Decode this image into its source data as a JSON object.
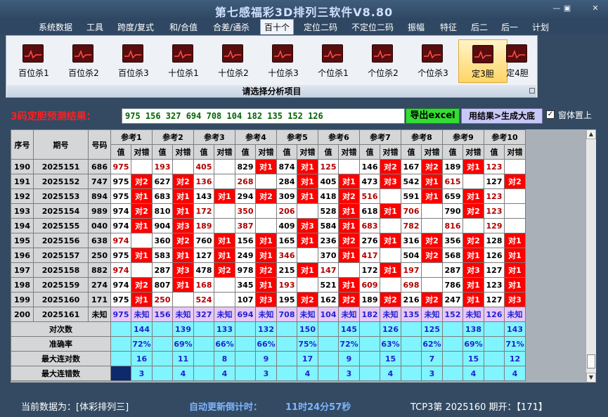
{
  "app": {
    "title": "第七感福彩3D排列三软件V8.80",
    "win_min": "—",
    "win_max": "▣",
    "win_close": "✕"
  },
  "menu": [
    "系统数据",
    "工具",
    "跨度/复式",
    "和/合值",
    "合差/通杀",
    "百十个",
    "定位二码",
    "不定位二码",
    "振幅",
    "特征",
    "后二",
    "后一",
    "计划"
  ],
  "menu_active": 5,
  "ribbon": {
    "buttons": [
      "百位杀1",
      "百位杀2",
      "百位杀3",
      "十位杀1",
      "十位杀2",
      "十位杀3",
      "个位杀1",
      "个位杀2",
      "个位杀3",
      "定3胆",
      "定4胆"
    ],
    "active": 9,
    "group_label": "请选择分析项目"
  },
  "result": {
    "label": "3码定胆预测结果：",
    "value": "975 156 327 694 708 104 182 135 152 126",
    "export_label": "导出excel",
    "tobig_label": "用结果>生成大底",
    "topmost_label": "窗体置上",
    "topmost_checked": "✓"
  },
  "grid": {
    "h_seq": "序号",
    "h_period": "期号",
    "h_num": "号码",
    "refs": [
      "参考1",
      "参考2",
      "参考3",
      "参考4",
      "参考5",
      "参考6",
      "参考7",
      "参考8",
      "参考9",
      "参考10"
    ],
    "sub_val": "值",
    "sub_hit": "对错",
    "rows": [
      {
        "seq": "190",
        "period": "2025151",
        "num": "686",
        "cells": [
          [
            "975",
            ""
          ],
          [
            "193",
            ""
          ],
          [
            "405",
            ""
          ],
          [
            "829",
            "对1"
          ],
          [
            "874",
            "对1"
          ],
          [
            "125",
            ""
          ],
          [
            "146",
            "对2"
          ],
          [
            "167",
            "对2"
          ],
          [
            "189",
            "对1"
          ],
          [
            "123",
            ""
          ]
        ]
      },
      {
        "seq": "191",
        "period": "2025152",
        "num": "747",
        "cells": [
          [
            "975",
            "对2"
          ],
          [
            "627",
            "对2"
          ],
          [
            "136",
            ""
          ],
          [
            "268",
            ""
          ],
          [
            "284",
            "对1"
          ],
          [
            "405",
            "对1"
          ],
          [
            "473",
            "对3"
          ],
          [
            "542",
            "对1"
          ],
          [
            "615",
            ""
          ],
          [
            "127",
            "对2"
          ]
        ]
      },
      {
        "seq": "192",
        "period": "2025153",
        "num": "894",
        "cells": [
          [
            "975",
            "对1"
          ],
          [
            "683",
            "对1"
          ],
          [
            "143",
            "对1"
          ],
          [
            "294",
            "对2"
          ],
          [
            "309",
            "对1"
          ],
          [
            "418",
            "对2"
          ],
          [
            "516",
            ""
          ],
          [
            "591",
            "对1"
          ],
          [
            "659",
            "对1"
          ],
          [
            "123",
            ""
          ]
        ]
      },
      {
        "seq": "193",
        "period": "2025154",
        "num": "989",
        "cells": [
          [
            "974",
            "对2"
          ],
          [
            "810",
            "对1"
          ],
          [
            "172",
            ""
          ],
          [
            "350",
            ""
          ],
          [
            "206",
            ""
          ],
          [
            "528",
            "对1"
          ],
          [
            "618",
            "对1"
          ],
          [
            "706",
            ""
          ],
          [
            "790",
            "对2"
          ],
          [
            "123",
            ""
          ]
        ]
      },
      {
        "seq": "194",
        "period": "2025155",
        "num": "040",
        "cells": [
          [
            "974",
            "对1"
          ],
          [
            "904",
            "对3"
          ],
          [
            "189",
            ""
          ],
          [
            "387",
            ""
          ],
          [
            "409",
            "对3"
          ],
          [
            "584",
            "对1"
          ],
          [
            "683",
            ""
          ],
          [
            "782",
            ""
          ],
          [
            "816",
            ""
          ],
          [
            "129",
            ""
          ]
        ]
      },
      {
        "seq": "195",
        "period": "2025156",
        "num": "638",
        "cells": [
          [
            "974",
            ""
          ],
          [
            "360",
            "对2"
          ],
          [
            "760",
            "对1"
          ],
          [
            "156",
            "对1"
          ],
          [
            "165",
            "对1"
          ],
          [
            "236",
            "对2"
          ],
          [
            "276",
            "对1"
          ],
          [
            "316",
            "对2"
          ],
          [
            "356",
            "对2"
          ],
          [
            "128",
            "对1"
          ]
        ]
      },
      {
        "seq": "196",
        "period": "2025157",
        "num": "250",
        "cells": [
          [
            "975",
            "对1"
          ],
          [
            "583",
            "对1"
          ],
          [
            "127",
            "对1"
          ],
          [
            "249",
            "对1"
          ],
          [
            "346",
            ""
          ],
          [
            "370",
            "对1"
          ],
          [
            "417",
            ""
          ],
          [
            "504",
            "对2"
          ],
          [
            "568",
            "对1"
          ],
          [
            "126",
            "对1"
          ]
        ]
      },
      {
        "seq": "197",
        "period": "2025158",
        "num": "882",
        "cells": [
          [
            "974",
            ""
          ],
          [
            "287",
            "对3"
          ],
          [
            "478",
            "对2"
          ],
          [
            "978",
            "对2"
          ],
          [
            "215",
            "对1"
          ],
          [
            "147",
            ""
          ],
          [
            "172",
            "对1"
          ],
          [
            "197",
            ""
          ],
          [
            "287",
            "对3"
          ],
          [
            "127",
            "对1"
          ]
        ]
      },
      {
        "seq": "198",
        "period": "2025159",
        "num": "274",
        "cells": [
          [
            "974",
            "对2"
          ],
          [
            "807",
            "对1"
          ],
          [
            "168",
            ""
          ],
          [
            "345",
            "对1"
          ],
          [
            "193",
            ""
          ],
          [
            "521",
            "对1"
          ],
          [
            "609",
            ""
          ],
          [
            "698",
            ""
          ],
          [
            "786",
            "对1"
          ],
          [
            "123",
            "对1"
          ]
        ]
      },
      {
        "seq": "199",
        "period": "2025160",
        "num": "171",
        "cells": [
          [
            "975",
            "对1"
          ],
          [
            "250",
            ""
          ],
          [
            "524",
            ""
          ],
          [
            "107",
            "对3"
          ],
          [
            "195",
            "对2"
          ],
          [
            "162",
            "对2"
          ],
          [
            "189",
            "对2"
          ],
          [
            "216",
            "对2"
          ],
          [
            "247",
            "对1"
          ],
          [
            "127",
            "对3"
          ]
        ]
      }
    ],
    "pred": {
      "seq": "200",
      "period": "2025161",
      "num": "未知",
      "cells": [
        [
          "975",
          "未知"
        ],
        [
          "156",
          "未知"
        ],
        [
          "327",
          "未知"
        ],
        [
          "694",
          "未知"
        ],
        [
          "708",
          "未知"
        ],
        [
          "104",
          "未知"
        ],
        [
          "182",
          "未知"
        ],
        [
          "135",
          "未知"
        ],
        [
          "152",
          "未知"
        ],
        [
          "126",
          "未知"
        ]
      ]
    },
    "stats": [
      {
        "label": "对次数",
        "values": [
          "144",
          "139",
          "133",
          "132",
          "150",
          "145",
          "126",
          "125",
          "138",
          "143"
        ]
      },
      {
        "label": "准确率",
        "values": [
          "72%",
          "69%",
          "66%",
          "66%",
          "75%",
          "72%",
          "63%",
          "62%",
          "69%",
          "71%"
        ]
      },
      {
        "label": "最大连对数",
        "values": [
          "16",
          "11",
          "8",
          "9",
          "17",
          "9",
          "15",
          "7",
          "15",
          "12"
        ]
      },
      {
        "label": "最大连错数",
        "values": [
          "3",
          "4",
          "4",
          "3",
          "4",
          "3",
          "4",
          "3",
          "4",
          "4"
        ]
      }
    ]
  },
  "status": {
    "source": "当前数据为：[体彩排列三]",
    "countdown_label": "自动更新倒计时：",
    "countdown_value": "11时24分57秒",
    "period": "TCP3第 2025160 期开：【171】"
  }
}
